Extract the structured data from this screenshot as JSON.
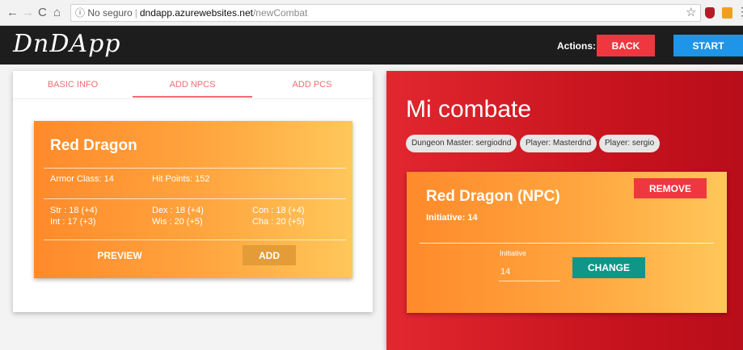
{
  "browser": {
    "info_label": "No seguro",
    "url_host": "dndapp.azurewebsites.net",
    "url_path": "/newCombat"
  },
  "header": {
    "logo": "DnDApp",
    "actions_label": "Actions:",
    "back_label": "BACK",
    "start_label": "START"
  },
  "left": {
    "tabs": [
      {
        "label": "BASIC INFO"
      },
      {
        "label": "ADD NPCS",
        "active": true
      },
      {
        "label": "ADD PCS"
      }
    ],
    "npc": {
      "name": "Red Dragon",
      "armor_class": "Armor Class: 14",
      "hit_points": "Hit Points: 152",
      "str": "Str : 18 (+4)",
      "dex": "Dex : 18 (+4)",
      "con": "Con : 18 (+4)",
      "int": "Int : 17 (+3)",
      "wis": "Wis : 20 (+5)",
      "cha": "Cha : 20 (+5)",
      "preview_label": "PREVIEW",
      "add_label": "ADD"
    }
  },
  "right": {
    "title": "Mi combate",
    "chips": {
      "dm": "Dungeon Master: sergiodnd",
      "p1": "Player: Masterdnd",
      "p2": "Player: sergio"
    },
    "combatant": {
      "name": "Red Dragon (NPC)",
      "initiative": "Initiative: 14",
      "remove_label": "REMOVE",
      "initiative_field_label": "Initiative",
      "initiative_value": "14",
      "change_label": "CHANGE"
    }
  },
  "colors": {
    "accent_red": "#f0373f",
    "accent_blue": "#1e95e8",
    "teal": "#0f9688",
    "card_orange": "#ff8a2a"
  }
}
